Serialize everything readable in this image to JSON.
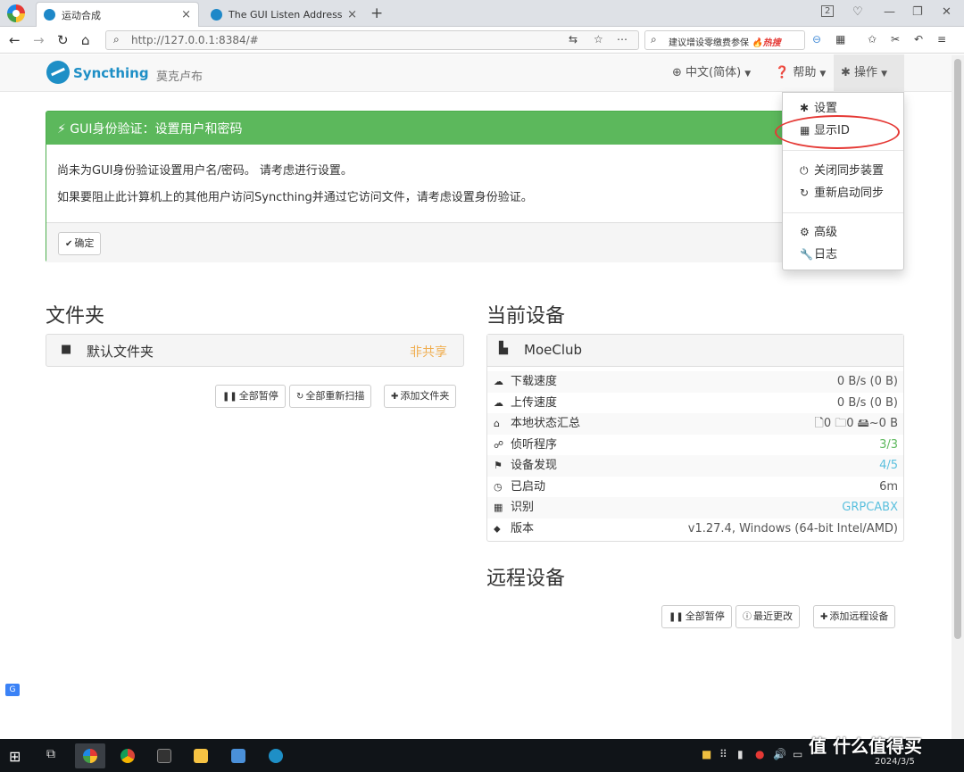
{
  "browser": {
    "tabs": [
      {
        "title": "运动合成",
        "close": "×"
      },
      {
        "title": "The GUI Listen Address —",
        "close": "×"
      }
    ],
    "new_tab": "+",
    "window_controls": [
      "2",
      "♡",
      "—",
      "❐",
      "✕"
    ],
    "url": "http://127.0.0.1:8384/#",
    "search_hint": "建议增设零缴费参保",
    "search_hot": "🔥热搜",
    "nav": {
      "back": "←",
      "forward": "→",
      "reload": "↻",
      "home": "⌂"
    }
  },
  "navbar": {
    "brand": "Syncthing",
    "device_name": "莫克卢布",
    "language": "中文(简体)",
    "help": "帮助",
    "actions": "操作"
  },
  "dropdown": {
    "items": [
      {
        "icon": "gear-icon",
        "glyph": "✱",
        "label": "设置"
      },
      {
        "icon": "qrcode-icon",
        "glyph": "▦",
        "label": "显示ID"
      },
      {
        "icon": "power-icon",
        "glyph": "⏻",
        "label": "关闭同步装置"
      },
      {
        "icon": "refresh-icon",
        "glyph": "↻",
        "label": "重新启动同步"
      },
      {
        "icon": "cogs-icon",
        "glyph": "⚙",
        "label": "高级"
      },
      {
        "icon": "wrench-icon",
        "glyph": "🔧",
        "label": "日志"
      }
    ]
  },
  "alert": {
    "title": "GUI身份验证：设置用户和密码",
    "line1": "尚未为GUI身份验证设置用户名/密码。 请考虑进行设置。",
    "line2": "如果要阻止此计算机上的其他用户访问Syncthing并通过它访问文件，请考虑设置身份验证。",
    "ok_button": "确定"
  },
  "folders": {
    "title": "文件夹",
    "items": [
      {
        "name": "默认文件夹",
        "status": "非共享"
      }
    ],
    "buttons": {
      "pause_all": "全部暂停",
      "rescan_all": "全部重新扫描",
      "add": "添加文件夹"
    }
  },
  "this_device": {
    "title": "当前设备",
    "name": "MoeClub",
    "rows": [
      {
        "label": "下载速度",
        "value": "0 B/s (0 B)",
        "style": ""
      },
      {
        "label": "上传速度",
        "value": "0 B/s (0 B)",
        "style": ""
      },
      {
        "label": "本地状态汇总",
        "value": "🗋0  🗀0  🖴~0 B",
        "style": ""
      },
      {
        "label": "侦听程序",
        "value": "3/3",
        "style": "green"
      },
      {
        "label": "设备发现",
        "value": "4/5",
        "style": "blue"
      },
      {
        "label": "已启动",
        "value": "6m",
        "style": ""
      },
      {
        "label": "识别",
        "value": "GRPCABX",
        "style": "blue"
      },
      {
        "label": "版本",
        "value": "v1.27.4, Windows (64-bit Intel/AMD)",
        "style": ""
      }
    ]
  },
  "remote_devices": {
    "title": "远程设备",
    "buttons": {
      "pause_all": "全部暂停",
      "recent_changes": "最近更改",
      "add": "添加远程设备"
    }
  },
  "taskbar": {
    "date": "2024/3/5",
    "watermark": "值 什么值得买"
  }
}
